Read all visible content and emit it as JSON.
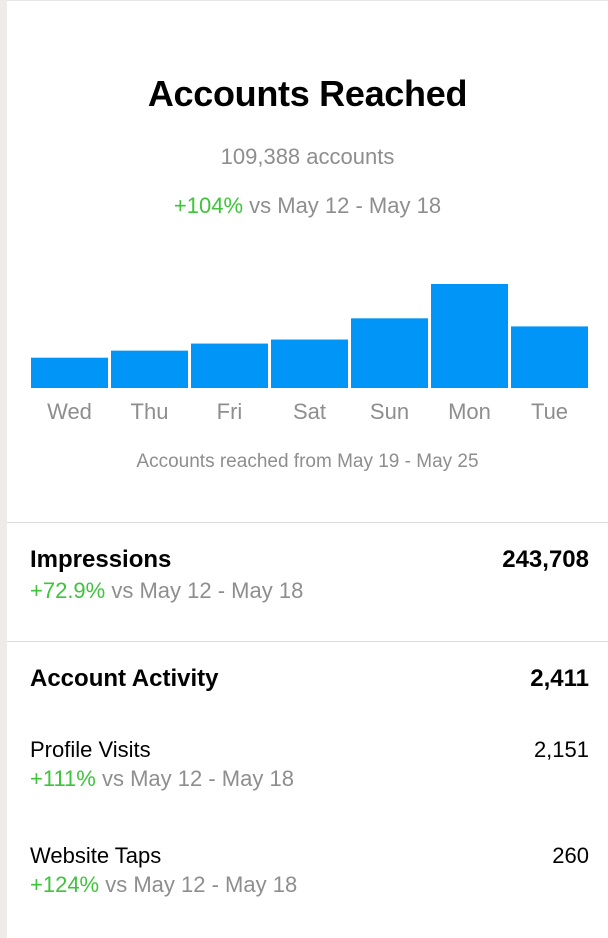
{
  "accounts_reached": {
    "title": "Accounts Reached",
    "count_text": "109,388 accounts",
    "change_pct": "+104%",
    "change_compare": " vs May 12 - May 18",
    "caption": "Accounts reached from May 19 - May 25"
  },
  "chart_data": {
    "type": "bar",
    "categories": [
      "Wed",
      "Thu",
      "Fri",
      "Sat",
      "Sun",
      "Mon",
      "Tue"
    ],
    "values": [
      30,
      37,
      44,
      48,
      69,
      103,
      61
    ],
    "ylim": [
      0,
      103
    ],
    "grid": false,
    "bar_color": "#0095f6"
  },
  "impressions": {
    "title": "Impressions",
    "value": "243,708",
    "change_pct": "+72.9%",
    "change_compare": " vs May 12 - May 18"
  },
  "account_activity": {
    "title": "Account Activity",
    "value": "2,411",
    "items": [
      {
        "title": "Profile Visits",
        "value": "2,151",
        "change_pct": "+111%",
        "change_compare": " vs May 12 - May 18"
      },
      {
        "title": "Website Taps",
        "value": "260",
        "change_pct": "+124%",
        "change_compare": " vs May 12 - May 18"
      }
    ]
  },
  "colors": {
    "positive": "#3ec43b",
    "muted": "#8e8e8e",
    "bar": "#0095f6"
  }
}
